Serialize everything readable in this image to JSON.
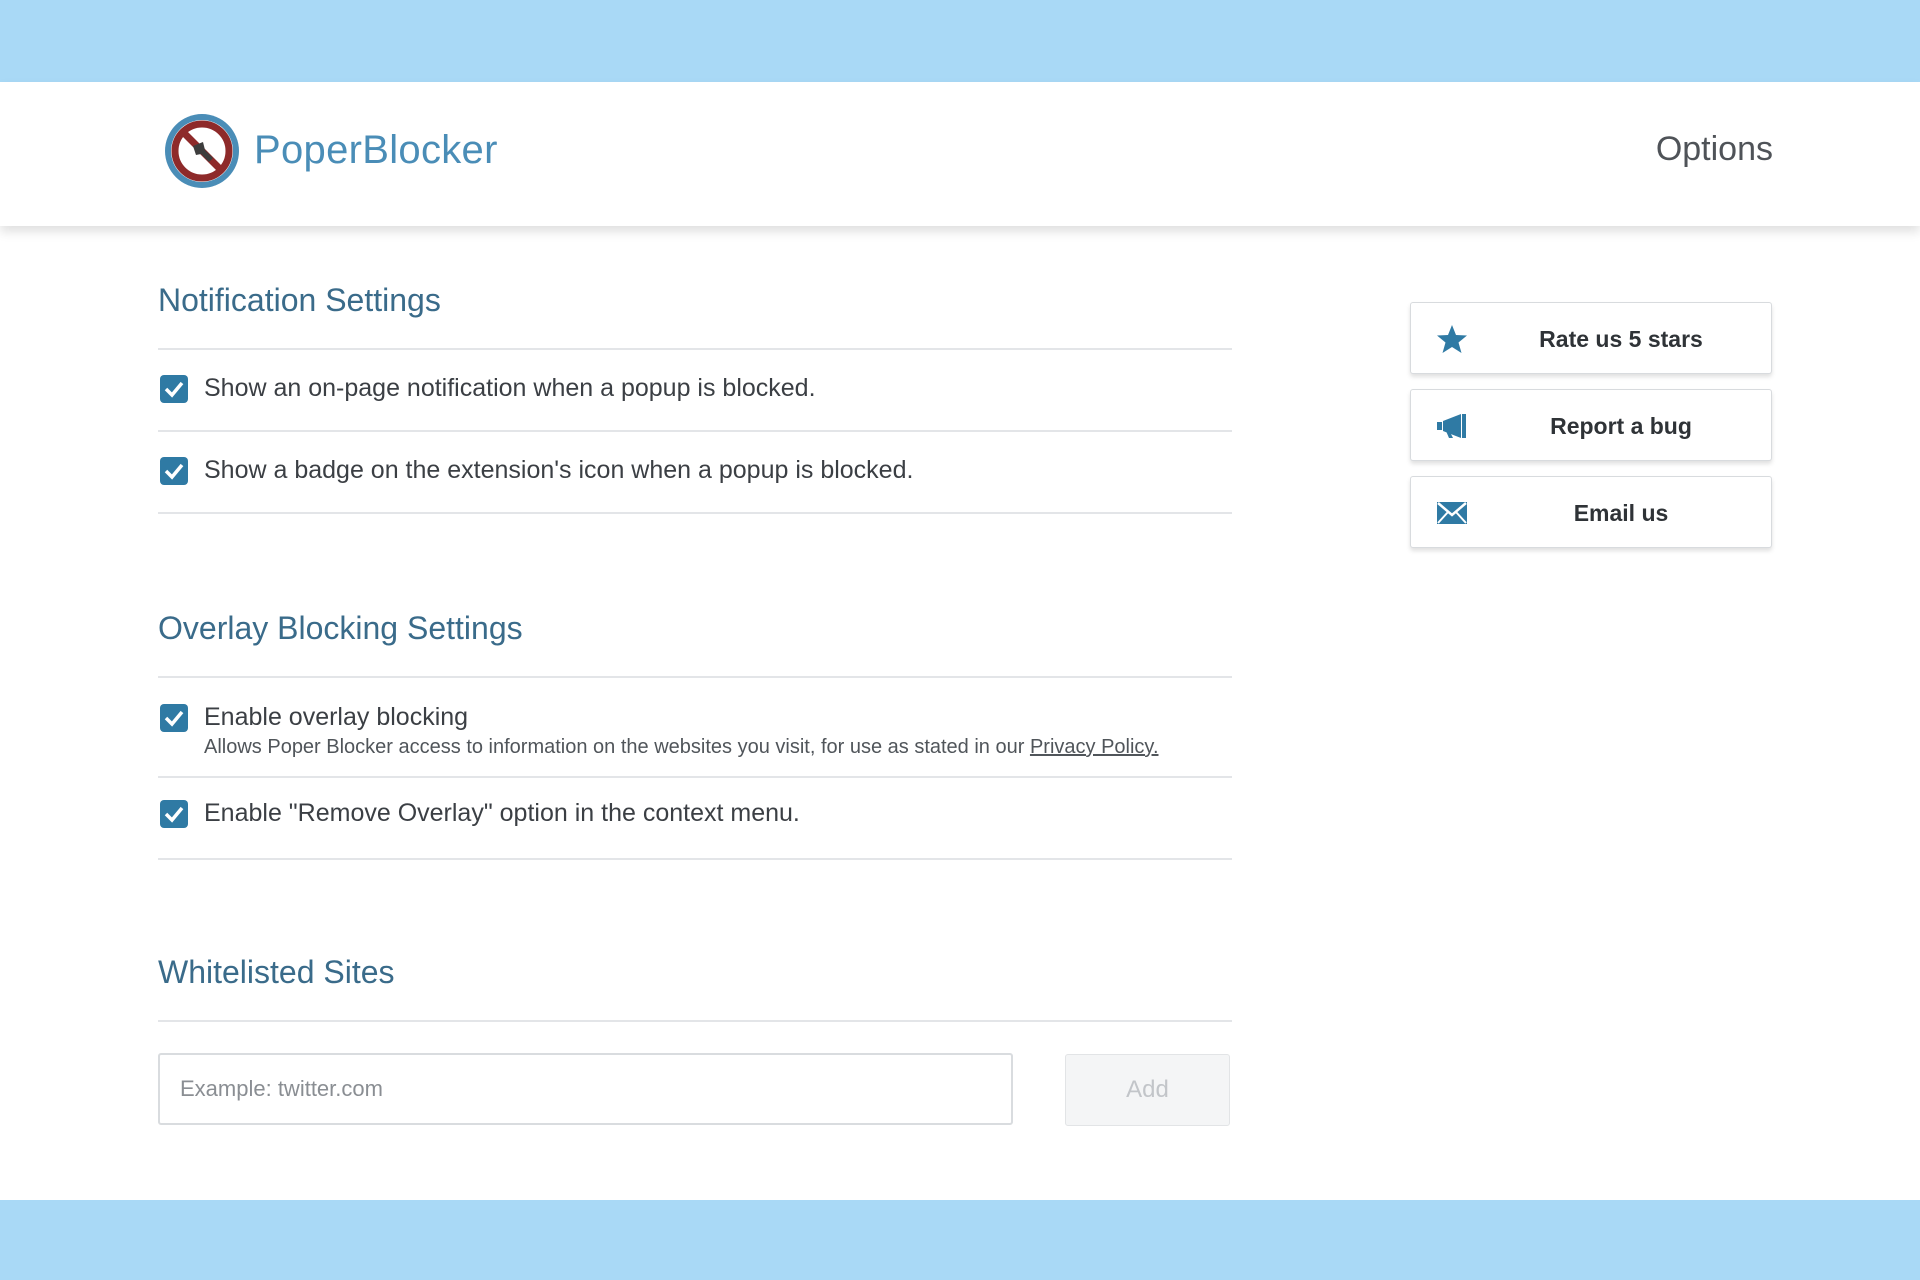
{
  "colors": {
    "band": "#a9d9f6",
    "brand": "#4a8db7",
    "accent": "#2f7aa4",
    "section_title": "#3a6b8a"
  },
  "header": {
    "brand": "PoperBlocker",
    "logo_icon": "no-popup-logo-icon",
    "options_label": "Options"
  },
  "notification": {
    "title": "Notification Settings",
    "items": [
      {
        "label": "Show an on-page notification when a popup is blocked.",
        "checked": true
      },
      {
        "label": "Show a badge on the extension's icon when a popup is blocked.",
        "checked": true
      }
    ]
  },
  "overlay": {
    "title": "Overlay Blocking Settings",
    "items": [
      {
        "label": "Enable overlay blocking",
        "description": "Allows Poper Blocker access to information on the websites you visit, for use as stated in our",
        "link": "Privacy Policy.",
        "checked": true
      },
      {
        "label": "Enable \"Remove Overlay\" option in the context menu.",
        "checked": true
      }
    ]
  },
  "whitelist": {
    "title": "Whitelisted Sites",
    "input_placeholder": "Example: twitter.com",
    "input_value": "",
    "add_label": "Add"
  },
  "sidebar": {
    "buttons": [
      {
        "label": "Rate us 5 stars",
        "icon": "star-icon"
      },
      {
        "label": "Report a bug",
        "icon": "megaphone-icon"
      },
      {
        "label": "Email us",
        "icon": "envelope-icon"
      }
    ]
  }
}
